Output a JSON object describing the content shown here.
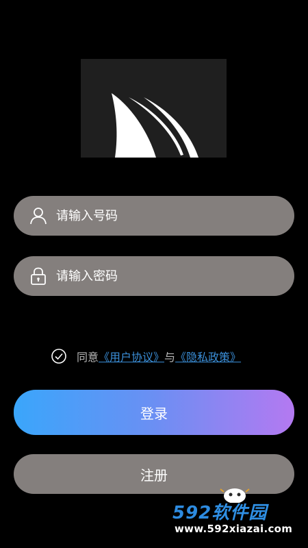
{
  "logo": {
    "icon": "sail-logo-icon"
  },
  "phone": {
    "placeholder": "请输入号码",
    "icon": "user-icon"
  },
  "password": {
    "placeholder": "请输入密码",
    "icon": "lock-icon"
  },
  "agreement": {
    "prefix": "同意",
    "user_agreement": "《用户协议》",
    "connector": "与",
    "privacy_policy": "《隐私政策》",
    "checked": true
  },
  "buttons": {
    "login": "登录",
    "register": "注册"
  },
  "watermark": {
    "brand_number": "592",
    "brand_text": "软件园",
    "url": "www.592xiazai.com"
  },
  "colors": {
    "background": "#000000",
    "field_bg": "#847f7d",
    "link": "#3b8fd9",
    "gradient_start": "#3aa6fb",
    "gradient_end": "#b479f1"
  }
}
